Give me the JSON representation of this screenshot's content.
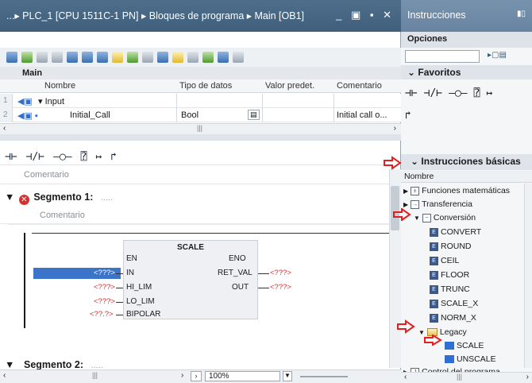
{
  "editor": {
    "title": "...▸ PLC_1 [CPU 1511C-1 PN] ▸ Bloques de programa ▸ Main [OB1]",
    "window_buttons": "_ ▣ ▪ ✕",
    "block_name": "Main",
    "interface": {
      "columns": [
        "Nombre",
        "Tipo de datos",
        "Valor predet.",
        "Comentario"
      ],
      "rows": [
        {
          "num": "1",
          "name": "▾ Input",
          "type": "",
          "default": "",
          "comment": ""
        },
        {
          "num": "2",
          "name": "Initial_Call",
          "type": "Bool",
          "default": "",
          "comment": "Initial call o..."
        }
      ]
    },
    "ladder_tools": [
      "⊣⊢",
      "⊣/⊢",
      "–◯–",
      "⍰",
      "↦",
      "↱"
    ],
    "comment_placeholder": "Comentario",
    "segment1": {
      "label": "Segmento 1:",
      "dots": ".....",
      "comment": "Comentario"
    },
    "block": {
      "name": "SCALE",
      "inputs": [
        "EN",
        "IN",
        "HI_LIM",
        "LO_LIM",
        "BIPOLAR"
      ],
      "outputs": [
        "ENO",
        "RET_VAL",
        "OUT"
      ],
      "in_params": [
        "<???>",
        "<???>",
        "<???>",
        "<??.?>"
      ],
      "out_params": [
        "<???>",
        "<???>"
      ]
    },
    "segment2": {
      "label": "Segmento 2:",
      "dots": "....."
    },
    "zoom": "100%"
  },
  "panel": {
    "title": "Instrucciones",
    "options_label": "Opciones",
    "favorites_label": "Favoritos",
    "fav_row1": [
      "⊣⊢",
      "⊣/⊢",
      "–◯–",
      "⍰",
      "↦"
    ],
    "fav_row2": [
      "↱"
    ],
    "basic_label": "Instrucciones básicas",
    "tree_header": "Nombre",
    "tree": [
      {
        "label": "Funciones matemáticas",
        "kind": "group"
      },
      {
        "label": "Transferencia",
        "kind": "group"
      },
      {
        "label": "Conversión",
        "kind": "group-open"
      },
      {
        "label": "CONVERT",
        "kind": "instr"
      },
      {
        "label": "ROUND",
        "kind": "instr"
      },
      {
        "label": "CEIL",
        "kind": "instr"
      },
      {
        "label": "FLOOR",
        "kind": "instr"
      },
      {
        "label": "TRUNC",
        "kind": "instr"
      },
      {
        "label": "SCALE_X",
        "kind": "instr"
      },
      {
        "label": "NORM_X",
        "kind": "instr"
      },
      {
        "label": "Legacy",
        "kind": "folder"
      },
      {
        "label": "SCALE",
        "kind": "fb"
      },
      {
        "label": "UNSCALE",
        "kind": "fb"
      },
      {
        "label": "Control del programa",
        "kind": "group"
      }
    ]
  },
  "colors": {
    "accent": "#3b74c9",
    "error": "#d92e2e",
    "arrow": "#e02020"
  }
}
